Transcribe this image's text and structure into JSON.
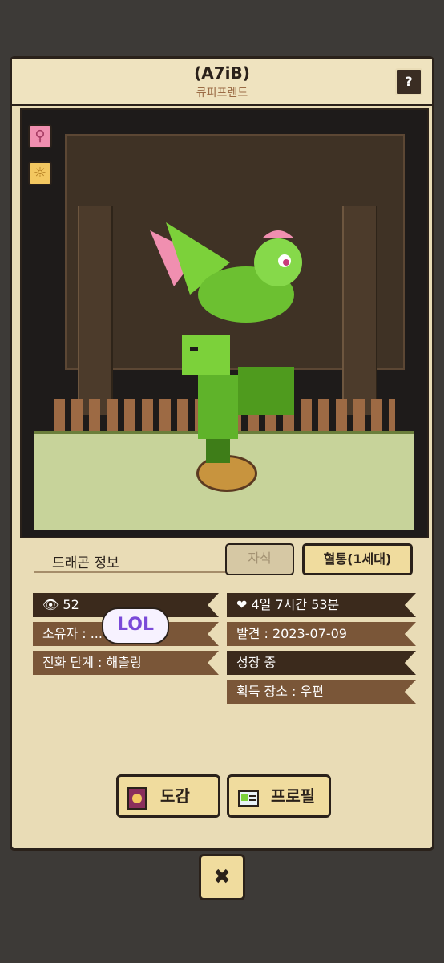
{
  "header": {
    "title": "(A7iB)",
    "subtitle": "큐피프렌드",
    "help_label": "?"
  },
  "badges": {
    "gender_icon": "female-icon",
    "element_icon": "sun-element-icon"
  },
  "info": {
    "section_title": "드래곤 정보",
    "tabs": [
      {
        "label": "자식",
        "active": false
      },
      {
        "label": "혈통(1세대)",
        "active": true
      }
    ],
    "left_stats": [
      {
        "label": "52",
        "icon": "eye-icon"
      },
      {
        "label": "소유자 : ..."
      },
      {
        "label": "진화 단계 : 해츨링"
      }
    ],
    "right_stats": [
      {
        "label": "4일 7시간 53분",
        "icon": "heart-timer-icon"
      },
      {
        "label": "발견 : 2023-07-09"
      },
      {
        "label": "성장 중"
      },
      {
        "label": "획득 장소 : 우편"
      }
    ],
    "sticker_text": "LOL"
  },
  "buttons": {
    "book_label": "도감",
    "profile_label": "프로필",
    "close_label": "✖"
  },
  "colors": {
    "panel": "#e9dcb6",
    "dark_stat": "#3b2a1c",
    "mid_stat": "#7a5638",
    "dragon_green": "#7cd13a",
    "dragon_pink": "#f08fb0"
  }
}
